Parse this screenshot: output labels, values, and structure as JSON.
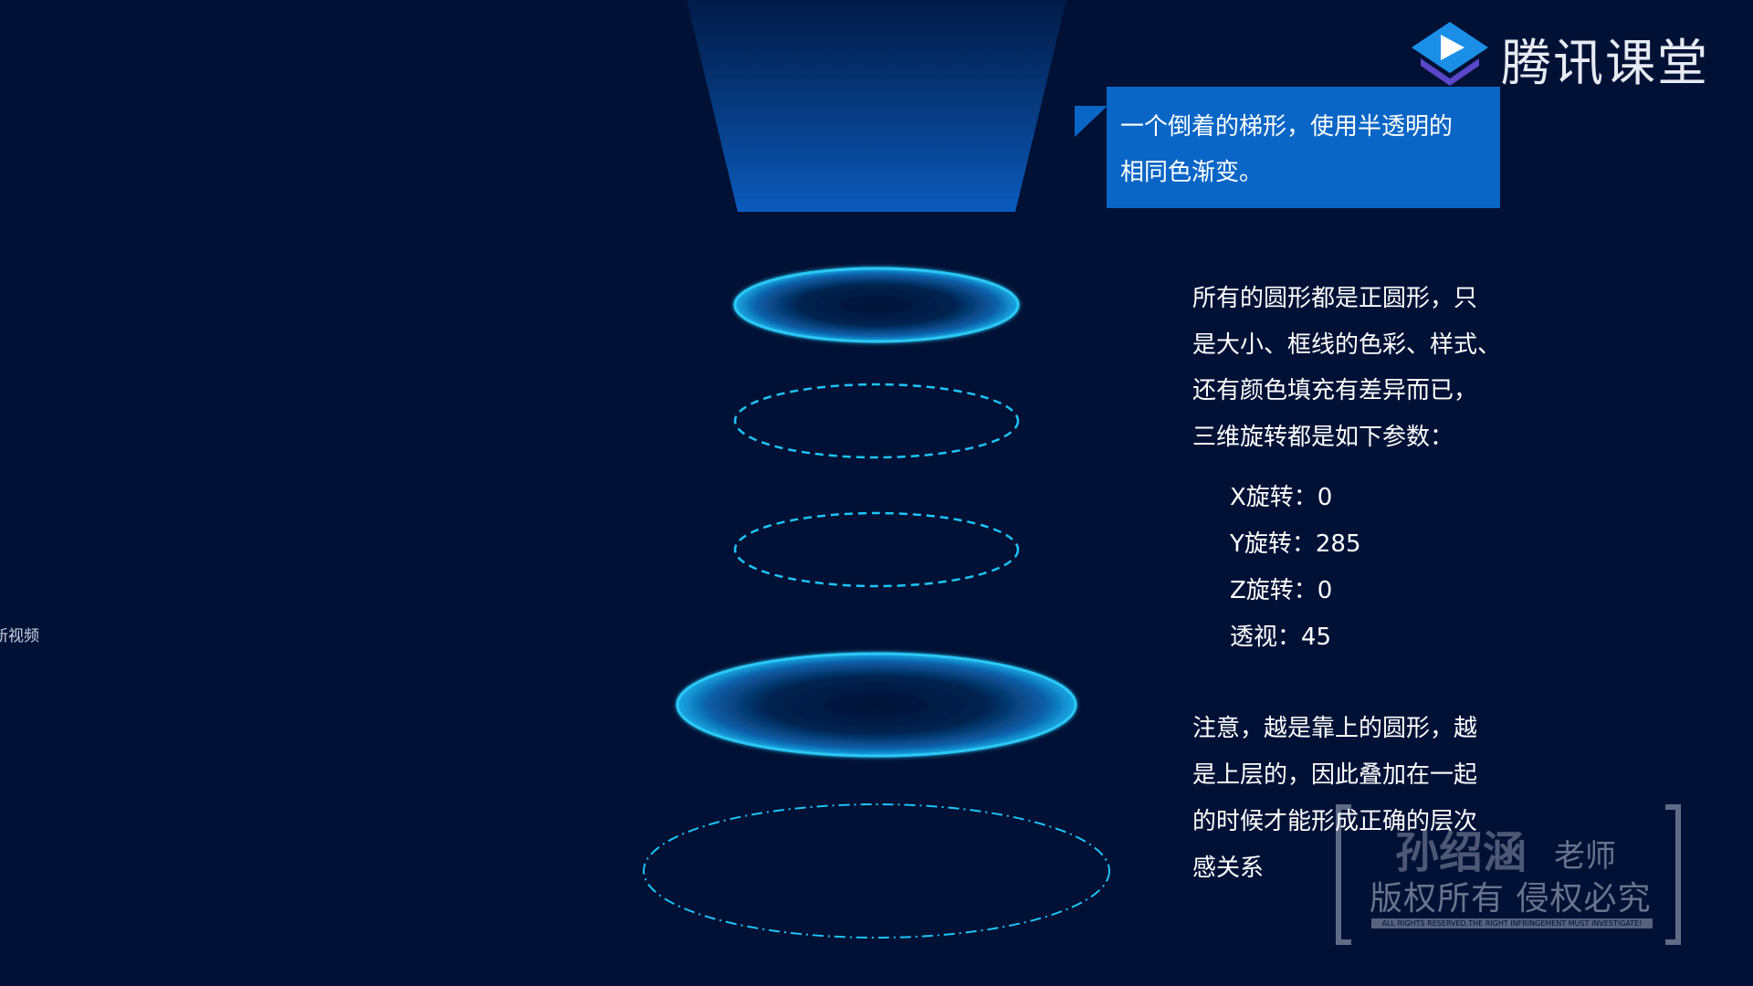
{
  "left_edge_text": "新视频",
  "logo": {
    "name": "腾讯课堂",
    "brand_color": "#1b8fe8"
  },
  "callout": {
    "line1": "一个倒着的梯形，使用半透明的",
    "line2": "相同色渐变。",
    "color": "#0a66c6"
  },
  "notes": {
    "lines": [
      "所有的圆形都是正圆形，只",
      "是大小、框线的色彩、样式、",
      "还有颜色填充有差异而已，",
      "三维旋转都是如下参数："
    ]
  },
  "params": {
    "x_rotation": "X旋转：0",
    "y_rotation": "Y旋转：285",
    "z_rotation": "Z旋转：0",
    "perspective": "透视：45"
  },
  "note2": {
    "lines": [
      "注意，越是靠上的圆形，越",
      "是上层的，因此叠加在一起",
      "的时候才能形成正确的层次",
      "感关系"
    ]
  },
  "watermark": {
    "name": "孙绍涵",
    "title": "老师",
    "rights": "版权所有 侵权必究",
    "small": "ALL RIGHTS RESERVED,THE RIGHT INFRINGEMENT MUST INVESTIGATE!"
  },
  "colors": {
    "background": "#001136",
    "ring_stroke": "#1ec4f4",
    "ring_glow": "#0e6fc0"
  }
}
